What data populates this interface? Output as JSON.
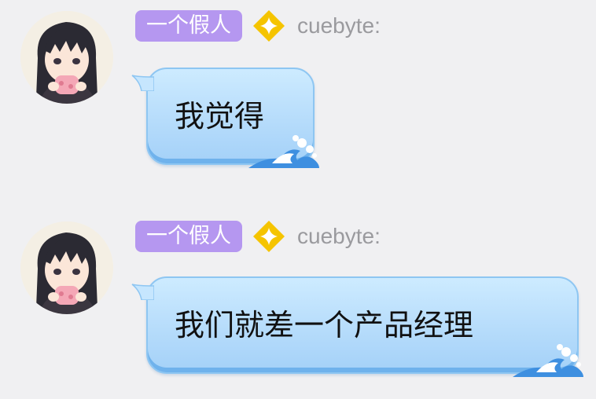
{
  "messages": [
    {
      "title_badge": "一个假人",
      "title_badge_color": "#b597f0",
      "badge_icon": "yellow-diamond-star-icon",
      "username": "cuebyte:",
      "text": "我觉得",
      "avatar": "anime-girl-avatar"
    },
    {
      "title_badge": "一个假人",
      "title_badge_color": "#b597f0",
      "badge_icon": "yellow-diamond-star-icon",
      "username": "cuebyte:",
      "text": "我们就差一个产品经理",
      "avatar": "anime-girl-avatar"
    }
  ],
  "colors": {
    "background": "#f0f0f2",
    "bubble": "#b6dcfb",
    "bubble_border": "#8ec6f2",
    "username": "#9a9a9e",
    "diamond": "#f5c400"
  }
}
